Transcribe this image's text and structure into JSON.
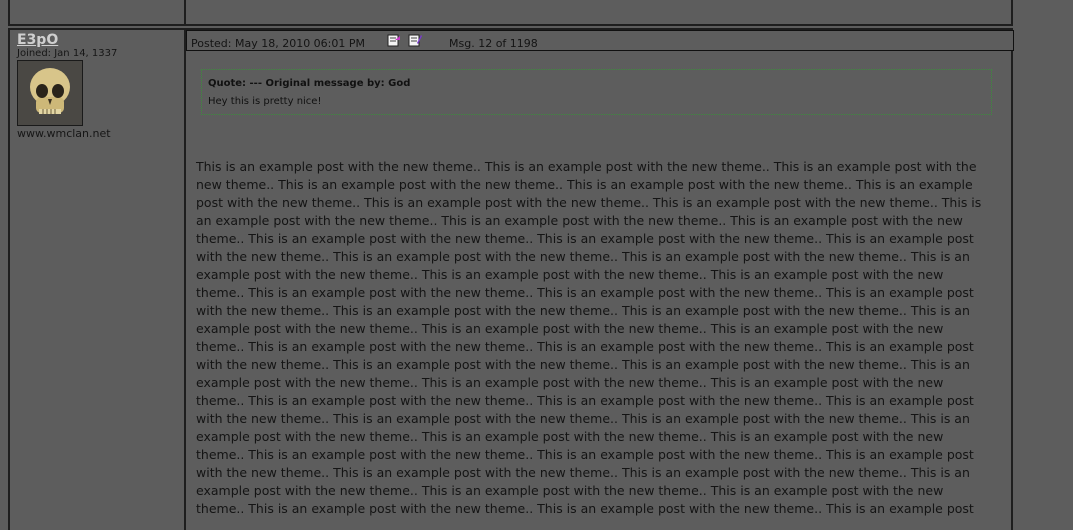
{
  "author": {
    "username": "E3pO",
    "joined": "Joined: Jan 14, 1337",
    "avatar_icon": "skull-avatar",
    "website": "www.wmclan.net"
  },
  "post": {
    "posted": "Posted: May 18, 2010 06:01 PM",
    "message_number": "Msg. 12 of 1198",
    "header_icons": [
      "quote-icon",
      "edit-icon"
    ],
    "quote": {
      "heading": "Quote: --- Original message by: God",
      "text": "Hey this is pretty nice!"
    },
    "body_lines": [
      "This is an example post with the new theme.. This is an example post with the new theme.. This is an example post with the",
      "new theme.. This is an example post with the new theme.. This is an example post with the new theme.. This is an example",
      "post with the new theme.. This is an example post with the new theme.. This is an example post with the new theme.. This is",
      "an example post with the new theme.. This is an example post with the new theme.. This is an example post with the new",
      "theme.. This is an example post with the new theme.. This is an example post with the new theme.. This is an example post",
      "with the new theme.. This is an example post with the new theme.. This is an example post with the new theme.. This is an",
      "example post with the new theme.. This is an example post with the new theme.. This is an example post with the new",
      "theme.. This is an example post with the new theme.. This is an example post with the new theme.. This is an example post",
      "with the new theme.. This is an example post with the new theme.. This is an example post with the new theme.. This is an",
      "example post with the new theme.. This is an example post with the new theme.. This is an example post with the new",
      "theme.. This is an example post with the new theme.. This is an example post with the new theme.. This is an example post",
      "with the new theme.. This is an example post with the new theme.. This is an example post with the new theme.. This is an",
      "example post with the new theme.. This is an example post with the new theme.. This is an example post with the new",
      "theme.. This is an example post with the new theme.. This is an example post with the new theme.. This is an example post",
      "with the new theme.. This is an example post with the new theme.. This is an example post with the new theme.. This is an",
      "example post with the new theme.. This is an example post with the new theme.. This is an example post with the new",
      "theme.. This is an example post with the new theme.. This is an example post with the new theme.. This is an example post",
      "with the new theme.. This is an example post with the new theme.. This is an example post with the new theme.. This is an",
      "example post with the new theme.. This is an example post with the new theme.. This is an example post with the new",
      "theme.. This is an example post with the new theme.. This is an example post with the new theme.. This is an example post"
    ]
  },
  "colors": {
    "background": "#5d5d5d",
    "border": "#1e1e1e",
    "quote_border": "#3c8c3c",
    "username": "#cfcfcf"
  }
}
